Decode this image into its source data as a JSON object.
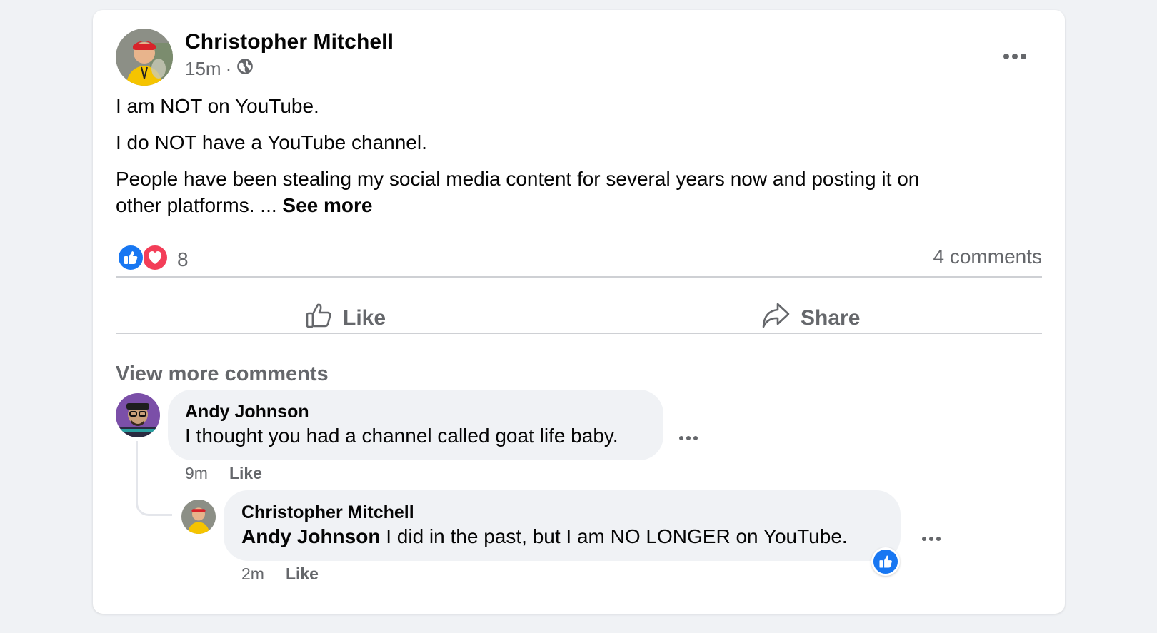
{
  "post": {
    "author": "Christopher Mitchell",
    "time": "15m",
    "separator": "·",
    "audience_icon": "globe-icon",
    "lines": [
      "I am NOT on YouTube.",
      "I do NOT have a YouTube channel.",
      "People have been stealing my social media content for several years now and posting it on",
      "other platforms. ..."
    ],
    "see_more": "See more",
    "reaction_count": "8",
    "comments_count": "4 comments",
    "actions": {
      "like": "Like",
      "share": "Share"
    }
  },
  "comments": {
    "view_more": "View more comments",
    "items": [
      {
        "author": "Andy Johnson",
        "text": "I thought you had a channel called goat life baby.",
        "time": "9m",
        "like": "Like"
      },
      {
        "author": "Christopher Mitchell",
        "mention": "Andy Johnson",
        "text": " I did in the past, but I am NO LONGER on YouTube.",
        "time": "2m",
        "like": "Like"
      }
    ]
  },
  "colors": {
    "like_blue": "#1877f2",
    "love_red": "#f33e58",
    "secondary_text": "#65676b",
    "bubble": "#f0f2f5"
  }
}
